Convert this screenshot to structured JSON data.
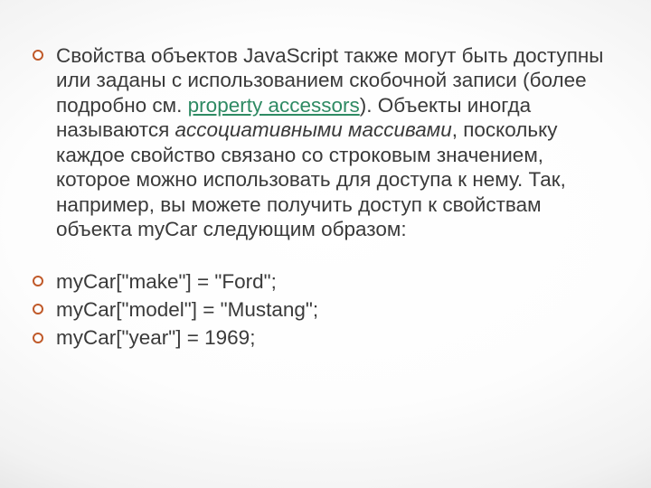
{
  "paragraph": {
    "t1": "Свойства объектов JavaScript также могут быть доступны или заданы с использованием скобочной записи (более подробно см. ",
    "link": "property accessors",
    "t2": "). Объекты иногда называются ",
    "italic": "ассоциативными массивами",
    "t3": ", поскольку каждое свойство связано со строковым значением, которое можно использовать для доступа к нему. Так, например, вы можете получить доступ к свойствам объекта myCar следующим образом:"
  },
  "code": {
    "line1": "myCar[\"make\"] = \"Ford\";",
    "line2": "myCar[\"model\"] = \"Mustang\";",
    "line3": "myCar[\"year\"] = 1969;"
  }
}
